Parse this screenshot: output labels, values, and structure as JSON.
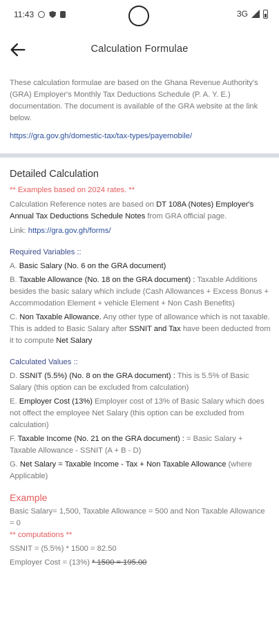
{
  "status": {
    "time": "11:43",
    "network": "3G"
  },
  "header": {
    "title": "Calculation Formulae"
  },
  "intro": {
    "text": "These calculation formulae are based on the Ghana Revenue Authority's (GRA) Employer's Monthly Tax Deductions Schedule (P. A. Y. E.) documentation. The document is available of the GRA website at the link below.",
    "link": "https://gra.gov.gh/domestic-tax/tax-types/payemobile/"
  },
  "detailed": {
    "title": "Detailed Calculation",
    "rates_note": "** Examples based on 2024 rates. **",
    "ref_prefix": "Calculation Reference notes are based on ",
    "ref_bold": "DT 108A (Notes) Employer's Annual Tax Deductions Schedule Notes",
    "ref_suffix": " from GRA official page.",
    "link_label": "Link: ",
    "link": "https://gra.gov.gh/forms/"
  },
  "required": {
    "title": "Required Variables ::",
    "a_prefix": "A. ",
    "a_bold": "Basic Salary (No. 6 on the GRA document)",
    "b_prefix": "B. ",
    "b_bold": "Taxable Allowance (No. 18 on the GRA document) :",
    "b_text": " Taxable Additions besides the basic salary which include (Cash Allowances + Excess Bonus + Accommodation Element + vehicle Element + Non Cash Benefits)",
    "c_prefix": "C. ",
    "c_bold": "Non Taxable Allowance.",
    "c_text": " Any other type of allowance which is not taxable. This is added to Basic Salary after ",
    "c_bold2": "SSNIT and Tax",
    "c_text2": " have been deducted from it to compute ",
    "c_bold3": "Net Salary"
  },
  "calculated": {
    "title": "Calculated Values ::",
    "d_prefix": "D. ",
    "d_bold": "SSNIT (5.5%)  (No. 8 on the GRA document) :",
    "d_text": " This is 5.5% of Basic Salary (this option can be excluded from calculation)",
    "e_prefix": "E. ",
    "e_bold": "Employer Cost (13%)",
    "e_text": " Employer cost of 13% of Basic Salary which does not offect the employee Net Salary (this option can be excluded from calculation)",
    "f_prefix": "F. ",
    "f_bold": "Taxable Income (No. 21 on the GRA document) :",
    "f_text": " = Basic Salary + Taxable Allowance - SSNIT (A + B - D)",
    "g_prefix": "G. ",
    "g_bold": "Net Salary = Taxable Income - Tax + Non Taxable Allowance",
    "g_text": " (where Applicable)"
  },
  "example": {
    "title": "Example",
    "inputs": "Basic Salary= 1,500, Taxable Allowance = 500 and Non Taxable Allowance = 0",
    "computations_label": "** computations **",
    "ssnit": "SSNIT = (5.5%) * 1500 = 82.50",
    "employer_prefix": "Employer Cost = (13%) ",
    "employer_strike": "* 1500 = 195.00"
  },
  "colors": {
    "accent_red": "#e55b5b",
    "link_blue": "#2a4f9c",
    "section_navy": "#3a4a8a",
    "divider": "#d8dce3"
  }
}
